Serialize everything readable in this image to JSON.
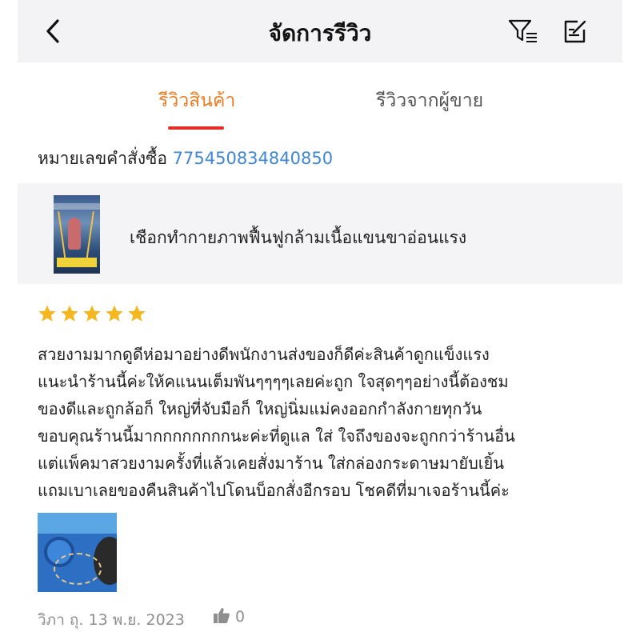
{
  "header": {
    "title": "จัดการรีวิว",
    "back_icon": "chevron-left-icon",
    "filter_icon": "filter-list-icon",
    "edit_icon": "edit-note-icon"
  },
  "tabs": [
    {
      "label": "รีวิวสินค้า",
      "active": true
    },
    {
      "label": "รีวิวจากผู้ขาย",
      "active": false
    }
  ],
  "order": {
    "label": "หมายเลขคำสั่งซื้อ",
    "number": "775450834840850"
  },
  "product": {
    "name": "เชือกทำกายภาพฟื้นฟูกล้ามเนื้อแขนขาอ่อนแรง"
  },
  "review": {
    "rating": 5,
    "max_rating": 5,
    "lines": [
      "สวยงามมากดูดีห่อมาอย่างดีพนักงานส่งของก็ดีค่ะสินค้าดูกแข็งแรง",
      "แนะนำร้านนี้ค่ะให้คแนนเต็มพันๆๆๆๆเลยค่ะถูก ใจสุดๆๆอย่างนี้ต้องชม",
      "ของดีและถูกล้อก็ ใหญ่ที่จับมือก็ ใหญ่นิ่มแม่คงออกกำลังกายทุกวัน",
      "ขอบคุณร้านนี้มากกกกกกกกนะค่ะที่ดูแล ใส่ ใจถึงของจะถูกกว่าร้านอื่น",
      "แต่แพ็คมาสวยงามครั้งที่แล้วเคยสั่งมาร้าน ใส่กล่องกระดาษมายับเยิ้น",
      "แถมเบาเลยของคืนสินค้าไปโดนบ็อกสั่งอีกรอบ โชคดีที่มาเจอร้านนี้ค่ะ"
    ],
    "date": "วิภา ถุ. 13 พ.ย. 2023",
    "likes": "0"
  },
  "colors": {
    "accent": "#ee7b22",
    "tab_underline": "#e52d27",
    "link": "#3f87d6",
    "star": "#f5b71f",
    "muted": "#8e8e8e",
    "header_bg": "#f3f3f5"
  }
}
